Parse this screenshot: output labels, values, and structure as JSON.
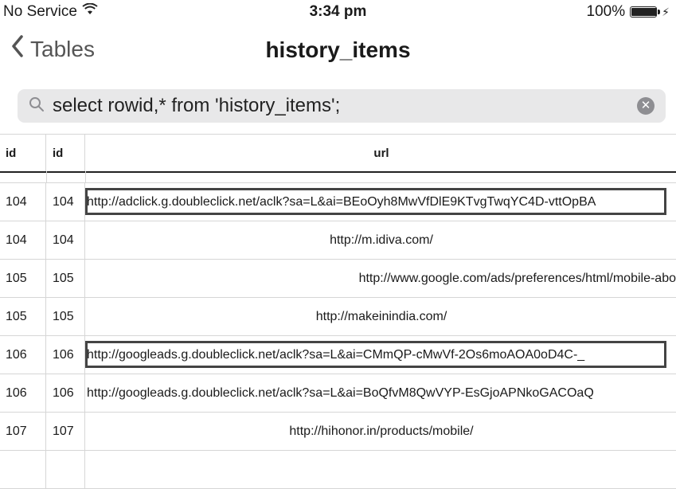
{
  "status": {
    "carrier": "No Service",
    "time": "3:34 pm",
    "battery": "100%",
    "battery_level": 1.0
  },
  "nav": {
    "back_label": "Tables",
    "title": "history_items"
  },
  "search": {
    "query": "select rowid,* from 'history_items';"
  },
  "table": {
    "columns": [
      "id",
      "id",
      "url"
    ],
    "rows": [
      {
        "rowid": "104",
        "id": "104",
        "url": "http://adclick.g.doubleclick.net/aclk?sa=L&ai=BEoOyh8MwVfDlE9KTvgTwqYC4D-vttOpBA",
        "align": "left",
        "highlight": true
      },
      {
        "rowid": "104",
        "id": "104",
        "url": "http://m.idiva.com/",
        "align": "center",
        "highlight": false
      },
      {
        "rowid": "105",
        "id": "105",
        "url": "http://www.google.com/ads/preferences/html/mobile-abo",
        "align": "right",
        "highlight": false
      },
      {
        "rowid": "105",
        "id": "105",
        "url": "http://makeinindia.com/",
        "align": "center",
        "highlight": false
      },
      {
        "rowid": "106",
        "id": "106",
        "url": "http://googleads.g.doubleclick.net/aclk?sa=L&ai=CMmQP-cMwVf-2Os6moAOA0oD4C-_",
        "align": "left",
        "highlight": true
      },
      {
        "rowid": "106",
        "id": "106",
        "url": "http://googleads.g.doubleclick.net/aclk?sa=L&ai=BoQfvM8QwVYP-EsGjoAPNkoGACOaQ",
        "align": "left",
        "highlight": false
      },
      {
        "rowid": "107",
        "id": "107",
        "url": "http://hihonor.in/products/mobile/",
        "align": "center",
        "highlight": false
      },
      {
        "rowid": "",
        "id": "",
        "url": "",
        "align": "left",
        "highlight": false
      }
    ]
  },
  "colors": {
    "highlight_border": "#444444",
    "search_bg": "#e8e8e9"
  }
}
